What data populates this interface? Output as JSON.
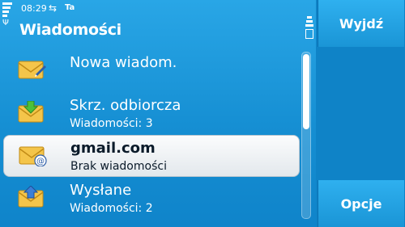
{
  "status": {
    "time": "08:29",
    "usb_icon": "usb-icon",
    "ta_text": "Ta"
  },
  "title": "Wiadomości",
  "items": [
    {
      "line1": "Nowa wiadom.",
      "line2": "",
      "icon": "new-message-icon"
    },
    {
      "line1": "Skrz. odbiorcza",
      "line2": "Wiadomości: 3",
      "icon": "inbox-icon"
    },
    {
      "line1": "gmail.com",
      "line2": "Brak wiadomości",
      "icon": "email-account-icon"
    },
    {
      "line1": "Wysłane",
      "line2": "Wiadomości: 2",
      "icon": "sent-icon"
    }
  ],
  "softkeys": {
    "exit": "Wyjdź",
    "options": "Opcje"
  },
  "colors": {
    "background": "#168fd3",
    "selection": "#f3f6f8",
    "envelope": "#f4c54a"
  }
}
